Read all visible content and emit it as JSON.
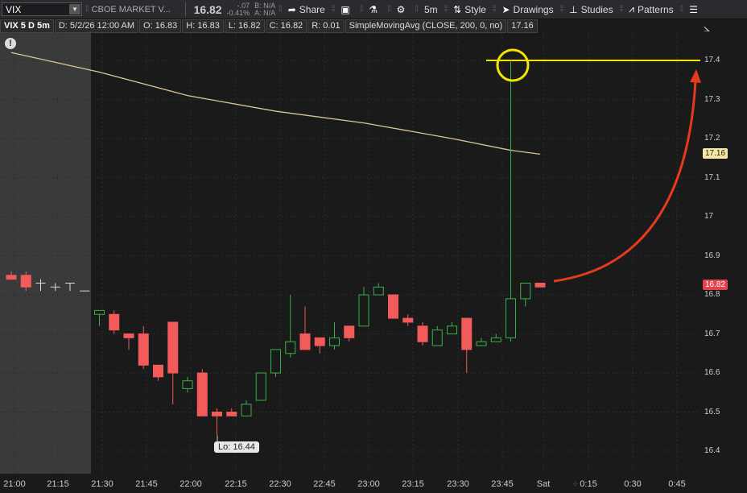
{
  "toolbar": {
    "symbol": "VIX",
    "title": "CBOE MARKET V...",
    "price": "16.82",
    "change": "-.07",
    "change_pct": "-0.41%",
    "bid": "B: N/A",
    "ask": "A: N/A",
    "share_label": "Share",
    "interval_label": "5m",
    "style_label": "Style",
    "drawings_label": "Drawings",
    "studies_label": "Studies",
    "patterns_label": "Patterns"
  },
  "infobar": {
    "ticker": "VIX 5 D 5m",
    "date": "D: 5/2/26 12:00 AM",
    "open": "O: 16.83",
    "high": "H: 16.83",
    "low": "L: 16.82",
    "close": "C: 16.82",
    "range": "R: 0.01",
    "study": "SimpleMovingAvg (CLOSE, 200, 0, no)",
    "study_value": "17.16"
  },
  "price_tags": {
    "sma": "17.16",
    "last": "16.82",
    "low_label": "Lo: 16.44"
  },
  "colors": {
    "up": "#36b24a",
    "down": "#f35a5a",
    "sma": "#d8c79a",
    "highlight": "#f2e600",
    "arrow": "#e63a1e",
    "last_tag": "#e3414c",
    "sma_tag": "#f5e7a5"
  },
  "chart_data": {
    "type": "candlestick",
    "ylim": [
      16.35,
      17.45
    ],
    "yticks": [
      "17.4",
      "17.3",
      "17.2",
      "17.1",
      "17",
      "16.9",
      "16.8",
      "16.7",
      "16.6",
      "16.5",
      "16.4"
    ],
    "xticks": [
      "21:00",
      "21:15",
      "21:30",
      "21:45",
      "22:00",
      "22:15",
      "22:30",
      "22:45",
      "23:00",
      "23:15",
      "23:30",
      "23:45",
      "Sat",
      "0:15",
      "0:30",
      "0:45"
    ],
    "candles": [
      {
        "o": 16.85,
        "h": 16.86,
        "l": 16.84,
        "c": 16.84
      },
      {
        "o": 16.85,
        "h": 16.86,
        "l": 16.81,
        "c": 16.82
      },
      {
        "o": 16.83,
        "h": 16.84,
        "l": 16.81,
        "c": 16.82
      },
      {
        "o": 16.82,
        "h": 16.83,
        "l": 16.81,
        "c": 16.82
      },
      {
        "o": 16.83,
        "h": 16.83,
        "l": 16.81,
        "c": 16.82
      },
      {
        "o": 16.81,
        "h": 16.81,
        "l": 16.81,
        "c": 16.81
      },
      {
        "o": 16.75,
        "h": 16.76,
        "l": 16.72,
        "c": 16.76
      },
      {
        "o": 16.75,
        "h": 16.76,
        "l": 16.7,
        "c": 16.71
      },
      {
        "o": 16.7,
        "h": 16.7,
        "l": 16.66,
        "c": 16.69
      },
      {
        "o": 16.7,
        "h": 16.72,
        "l": 16.61,
        "c": 16.62
      },
      {
        "o": 16.62,
        "h": 16.62,
        "l": 16.58,
        "c": 16.59
      },
      {
        "o": 16.73,
        "h": 16.73,
        "l": 16.52,
        "c": 16.6
      },
      {
        "o": 16.56,
        "h": 16.59,
        "l": 16.55,
        "c": 16.58
      },
      {
        "o": 16.6,
        "h": 16.61,
        "l": 16.49,
        "c": 16.49
      },
      {
        "o": 16.5,
        "h": 16.51,
        "l": 16.44,
        "c": 16.49
      },
      {
        "o": 16.5,
        "h": 16.51,
        "l": 16.49,
        "c": 16.49
      },
      {
        "o": 16.49,
        "h": 16.53,
        "l": 16.49,
        "c": 16.52
      },
      {
        "o": 16.53,
        "h": 16.6,
        "l": 16.53,
        "c": 16.6
      },
      {
        "o": 16.6,
        "h": 16.66,
        "l": 16.59,
        "c": 16.66
      },
      {
        "o": 16.65,
        "h": 16.8,
        "l": 16.64,
        "c": 16.68
      },
      {
        "o": 16.7,
        "h": 16.77,
        "l": 16.66,
        "c": 16.66
      },
      {
        "o": 16.69,
        "h": 16.69,
        "l": 16.65,
        "c": 16.67
      },
      {
        "o": 16.67,
        "h": 16.73,
        "l": 16.66,
        "c": 16.69
      },
      {
        "o": 16.72,
        "h": 16.72,
        "l": 16.68,
        "c": 16.69
      },
      {
        "o": 16.72,
        "h": 16.82,
        "l": 16.72,
        "c": 16.8
      },
      {
        "o": 16.8,
        "h": 16.83,
        "l": 16.8,
        "c": 16.82
      },
      {
        "o": 16.8,
        "h": 16.8,
        "l": 16.74,
        "c": 16.74
      },
      {
        "o": 16.74,
        "h": 16.75,
        "l": 16.72,
        "c": 16.73
      },
      {
        "o": 16.72,
        "h": 16.73,
        "l": 16.67,
        "c": 16.68
      },
      {
        "o": 16.67,
        "h": 16.72,
        "l": 16.67,
        "c": 16.71
      },
      {
        "o": 16.7,
        "h": 16.73,
        "l": 16.7,
        "c": 16.72
      },
      {
        "o": 16.74,
        "h": 16.74,
        "l": 16.6,
        "c": 16.66
      },
      {
        "o": 16.67,
        "h": 16.69,
        "l": 16.67,
        "c": 16.68
      },
      {
        "o": 16.68,
        "h": 16.7,
        "l": 16.68,
        "c": 16.69
      },
      {
        "o": 16.69,
        "h": 17.4,
        "l": 16.68,
        "c": 16.79
      },
      {
        "o": 16.79,
        "h": 16.83,
        "l": 16.77,
        "c": 16.83
      },
      {
        "o": 16.83,
        "h": 16.83,
        "l": 16.82,
        "c": 16.82
      }
    ],
    "sma": [
      {
        "i": 0,
        "v": 17.42
      },
      {
        "i": 6,
        "v": 17.37
      },
      {
        "i": 12,
        "v": 17.31
      },
      {
        "i": 18,
        "v": 17.27
      },
      {
        "i": 24,
        "v": 17.24
      },
      {
        "i": 30,
        "v": 17.2
      },
      {
        "i": 34,
        "v": 17.17
      },
      {
        "i": 36,
        "v": 17.16
      }
    ],
    "highlight_level": 17.4
  }
}
